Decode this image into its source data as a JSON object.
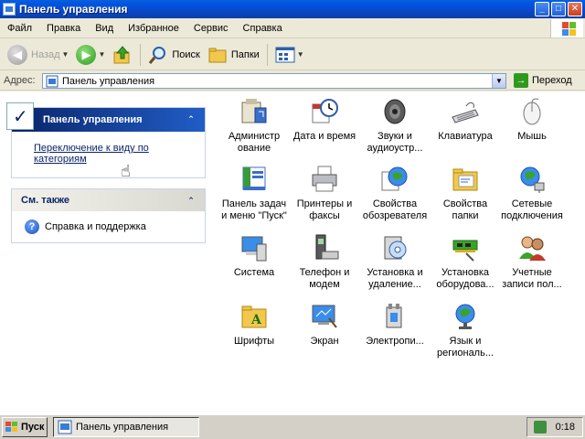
{
  "window": {
    "title": "Панель управления",
    "controls": {
      "minimize": "_",
      "maximize": "□",
      "close": "✕"
    }
  },
  "menu": [
    "Файл",
    "Правка",
    "Вид",
    "Избранное",
    "Сервис",
    "Справка"
  ],
  "toolbar": {
    "back_label": "Назад",
    "search_label": "Поиск",
    "folders_label": "Папки"
  },
  "address": {
    "label": "Адрес:",
    "value": "Панель управления",
    "go_label": "Переход"
  },
  "sidebar": {
    "panel1": {
      "title": "Панель управления",
      "link_line1": "Переключение к виду по",
      "link_line2": "категориям"
    },
    "panel2": {
      "title": "См. также",
      "item": "Справка и поддержка"
    }
  },
  "items": [
    {
      "line1": "Администр",
      "line2": "ование",
      "icon": "admin-tools-icon"
    },
    {
      "line1": "Дата и время",
      "line2": "",
      "icon": "datetime-icon"
    },
    {
      "line1": "Звуки и",
      "line2": "аудиоустр...",
      "icon": "sounds-icon"
    },
    {
      "line1": "Клавиатура",
      "line2": "",
      "icon": "keyboard-icon"
    },
    {
      "line1": "Мышь",
      "line2": "",
      "icon": "mouse-icon"
    },
    {
      "line1": "Панель задач",
      "line2": "и меню \"Пуск\"",
      "icon": "taskbar-icon"
    },
    {
      "line1": "Принтеры и",
      "line2": "факсы",
      "icon": "printers-icon"
    },
    {
      "line1": "Свойства",
      "line2": "обозревателя",
      "icon": "internet-options-icon"
    },
    {
      "line1": "Свойства",
      "line2": "папки",
      "icon": "folder-options-icon"
    },
    {
      "line1": "Сетевые",
      "line2": "подключения",
      "icon": "network-icon"
    },
    {
      "line1": "Система",
      "line2": "",
      "icon": "system-icon"
    },
    {
      "line1": "Телефон и",
      "line2": "модем",
      "icon": "phone-modem-icon"
    },
    {
      "line1": "Установка и",
      "line2": "удаление...",
      "icon": "add-remove-icon"
    },
    {
      "line1": "Установка",
      "line2": "оборудова...",
      "icon": "add-hardware-icon"
    },
    {
      "line1": "Учетные",
      "line2": "записи пол...",
      "icon": "user-accounts-icon"
    },
    {
      "line1": "Шрифты",
      "line2": "",
      "icon": "fonts-icon"
    },
    {
      "line1": "Экран",
      "line2": "",
      "icon": "display-icon"
    },
    {
      "line1": "Электропи...",
      "line2": "",
      "icon": "power-icon"
    },
    {
      "line1": "Язык и",
      "line2": "региональ...",
      "icon": "regional-icon"
    }
  ],
  "taskbar": {
    "start_label": "Пуск",
    "task_label": "Панель управления",
    "clock": "0:18"
  }
}
